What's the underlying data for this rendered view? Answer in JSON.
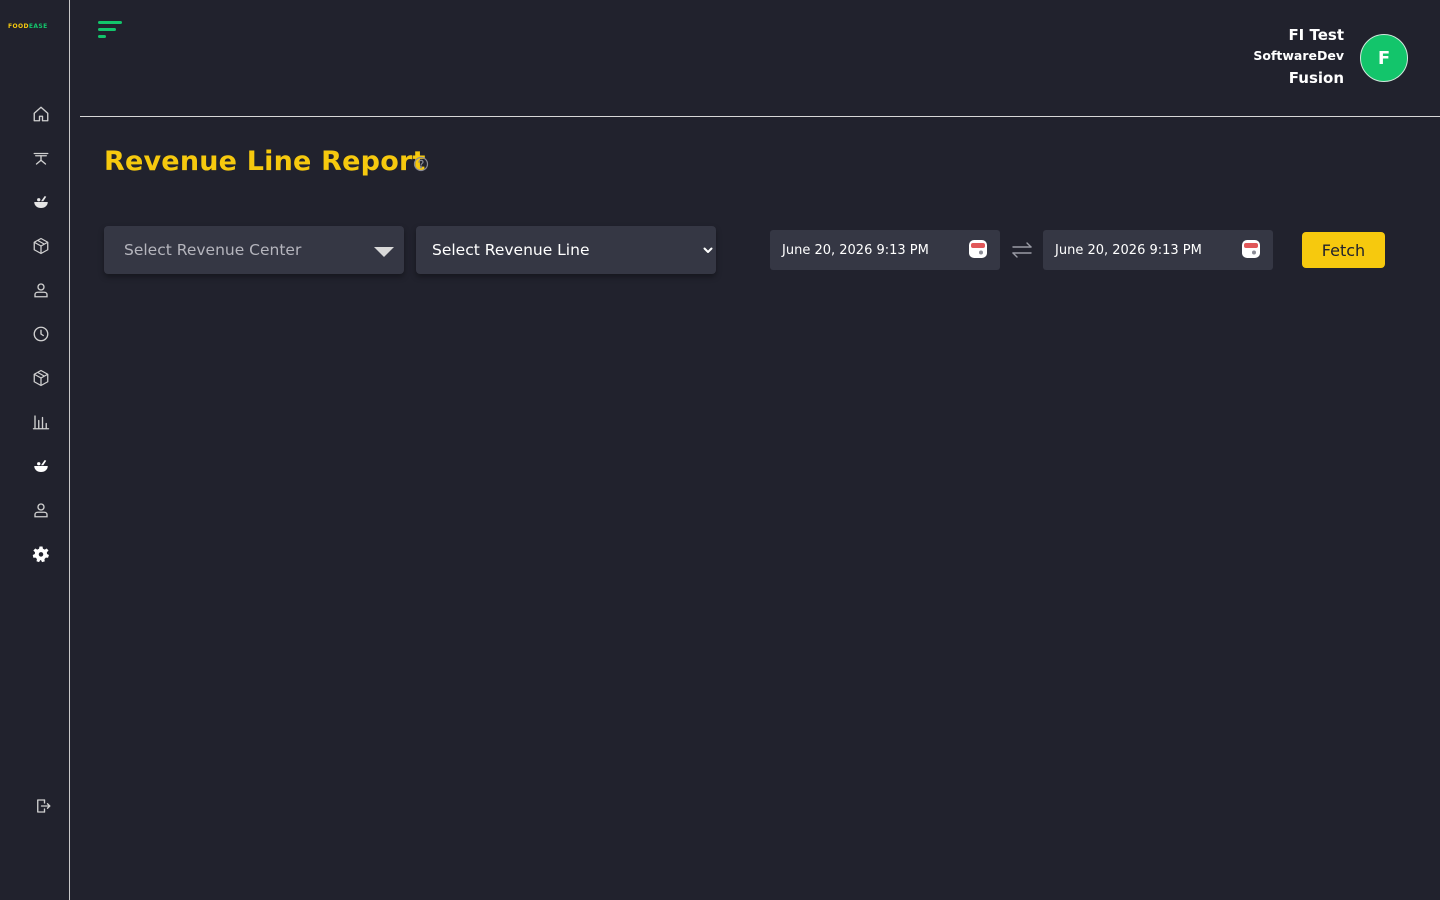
{
  "brand": {
    "logo_left": "FOOD",
    "logo_right": "EASE",
    "accent_yellow": "#f6c90e",
    "accent_green": "#13c56b",
    "background": "#21222d",
    "surface": "#353744"
  },
  "sidebar": {
    "items": [
      {
        "icon": "home-icon"
      },
      {
        "icon": "dining-table-icon"
      },
      {
        "icon": "food-bowl-icon"
      },
      {
        "icon": "package-icon"
      },
      {
        "icon": "user-icon"
      },
      {
        "icon": "clock-icon"
      },
      {
        "icon": "package-icon"
      },
      {
        "icon": "bar-chart-icon"
      },
      {
        "icon": "food-bowl-icon"
      },
      {
        "icon": "user-icon"
      },
      {
        "icon": "settings-gear-icon"
      }
    ],
    "logout_icon": "logout-icon"
  },
  "header": {
    "user_name": "FI Test",
    "company_line1": "SoftwareDev",
    "company_line2": "Fusion",
    "avatar_letter": "F"
  },
  "page": {
    "title": "Revenue Line Report"
  },
  "filters": {
    "revenue_center_placeholder": "Select Revenue Center",
    "revenue_line_selected": "Select Revenue Line",
    "date_from": "June 20, 2026 9:13 PM",
    "date_to": "June 20, 2026 9:13 PM",
    "fetch_label": "Fetch"
  }
}
